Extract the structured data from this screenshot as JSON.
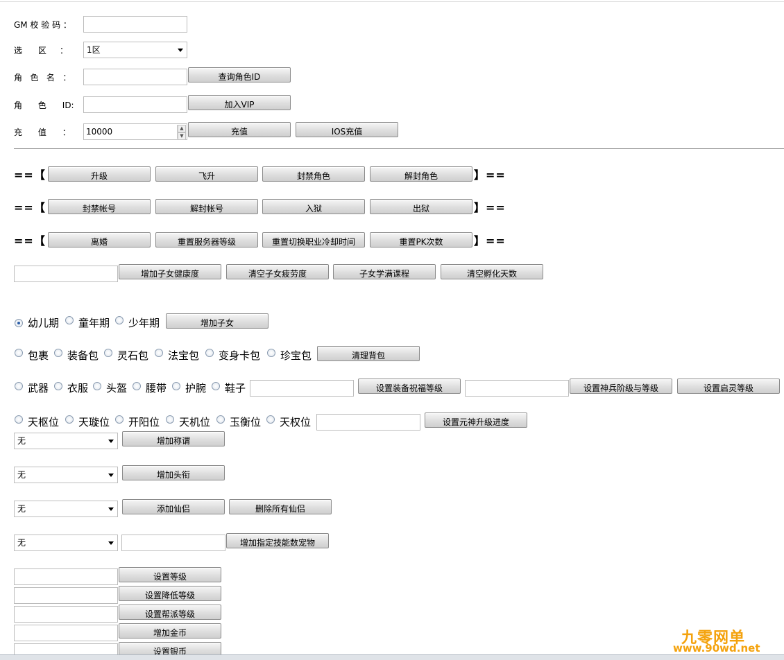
{
  "form": {
    "gm_code_label": "GM 校 验 码 ：",
    "gm_code_value": "",
    "zone_label": "选      区     ：",
    "zone_value": "1区",
    "role_name_label": "角   色   名   ：",
    "role_name_value": "",
    "query_role_id_button": "查询角色ID",
    "role_id_label": "角      色      ID:",
    "role_id_value": "",
    "add_vip_button": "加入VIP",
    "recharge_label": "充      值      ：",
    "recharge_value": "10000",
    "recharge_button": "充值",
    "ios_recharge_button": "IOS充值"
  },
  "bracket_open": "==【",
  "bracket_close": "】==",
  "row1": [
    "升级",
    "飞升",
    "封禁角色",
    "解封角色"
  ],
  "row2": [
    "封禁帐号",
    "解封帐号",
    "入狱",
    "出狱"
  ],
  "row3": [
    "离婚",
    "重置服务器等级",
    "重置切换职业冷却时间",
    "重置PK次数"
  ],
  "child_ops": [
    "增加子女健康度",
    "清空子女疲劳度",
    "子女学满课程",
    "清空孵化天数"
  ],
  "child_stages": [
    "幼儿期",
    "童年期",
    "少年期"
  ],
  "add_child_button": "增加子女",
  "bags": [
    "包裹",
    "装备包",
    "灵石包",
    "法宝包",
    "变身卡包",
    "珍宝包"
  ],
  "clear_bag_button": "清理背包",
  "equip_slots": [
    "武器",
    "衣服",
    "头盔",
    "腰带",
    "护腕",
    "鞋子"
  ],
  "equip_bless_button": "设置装备祝福等级",
  "weapon_stage_button": "设置神兵阶级与等级",
  "qiling_button": "设置启灵等级",
  "yuanshen_slots": [
    "天枢位",
    "天璇位",
    "开阳位",
    "天机位",
    "玉衡位",
    "天权位"
  ],
  "yuanshen_button": "设置元神升级进度",
  "dropdowns": {
    "title_value": "无",
    "add_title_button": "增加称谓",
    "rank_value": "无",
    "add_rank_button": "增加头衔",
    "partner_value": "无",
    "add_partner_button": "添加仙侣",
    "delete_partners_button": "删除所有仙侣",
    "pet_value": "无",
    "add_pet_button": "增加指定技能数宠物"
  },
  "level_ops": [
    "设置等级",
    "设置降低等级",
    "设置帮派等级",
    "增加金币",
    "设置银币"
  ],
  "watermark": {
    "line1": "九零网单",
    "line2": "www.90wd.net"
  }
}
